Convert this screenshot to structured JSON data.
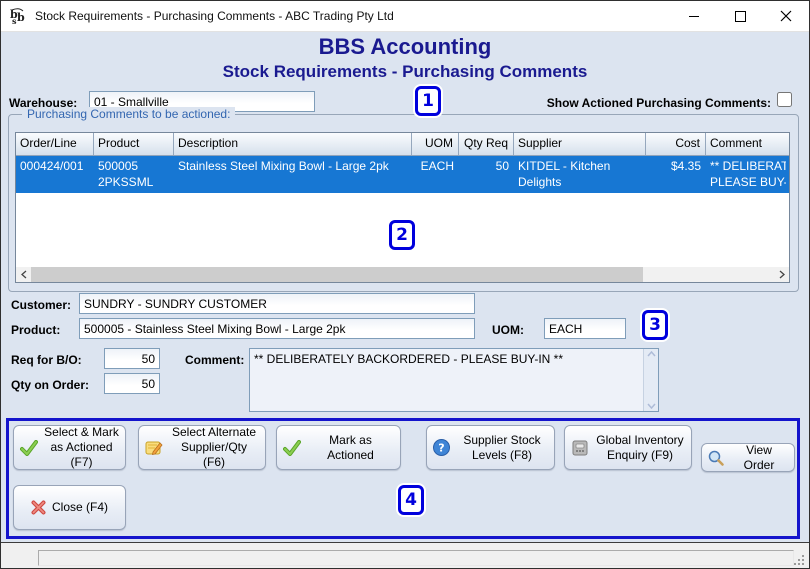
{
  "titlebar": {
    "title": "Stock Requirements - Purchasing Comments - ABC Trading Pty Ltd"
  },
  "header": {
    "app_title": "BBS Accounting",
    "screen_title": "Stock Requirements - Purchasing Comments"
  },
  "toolbar": {
    "warehouse_label": "Warehouse:",
    "warehouse_value": "01 - Smallville",
    "show_actioned_label": "Show Actioned Purchasing Comments:",
    "show_actioned_checked": false
  },
  "annotations": {
    "b1": "1",
    "b2": "2",
    "b3": "3",
    "b4": "4"
  },
  "grid": {
    "group_label": "Purchasing Comments to be actioned:",
    "columns": [
      "Order/Line",
      "Product",
      "Description",
      "UOM",
      "Qty Req",
      "Supplier",
      "Cost",
      "Comment"
    ],
    "rows": [
      {
        "order_line": "000424/001",
        "product": "500005 2PKSSML",
        "description": "Stainless Steel Mixing Bowl - Large 2pk",
        "uom": "EACH",
        "qty_req": "50",
        "supplier": "KITDEL - Kitchen Delights",
        "cost": "$4.35",
        "comment_line1": "** DELIBERATELY BACKORDERED -",
        "comment_line2": "PLEASE BUY-IN **"
      }
    ]
  },
  "detail": {
    "customer_label": "Customer:",
    "customer_value": "SUNDRY - SUNDRY CUSTOMER",
    "product_label": "Product:",
    "product_value": "500005 - Stainless Steel Mixing Bowl - Large 2pk",
    "uom_label": "UOM:",
    "uom_value": "EACH",
    "req_bo_label": "Req for B/O:",
    "req_bo_value": "50",
    "qty_on_order_label": "Qty on Order:",
    "qty_on_order_value": "50",
    "comment_label": "Comment:",
    "comment_value": "** DELIBERATELY BACKORDERED - PLEASE BUY-IN **"
  },
  "actions": {
    "select_mark_label": "Select & Mark as Actioned (F7)",
    "select_alternate_label": "Select Alternate Supplier/Qty (F6)",
    "mark_actioned_label": "Mark as Actioned",
    "supplier_stock_label": "Supplier Stock Levels (F8)",
    "global_inventory_label": "Global Inventory Enquiry (F9)",
    "view_order_label": "View Order",
    "close_label": "Close (F4)"
  },
  "colors": {
    "accent_navy": "#1a1a90",
    "selection_blue": "#1777d3",
    "annotation_blue": "#0000dd",
    "panel_border_blue": "#1414cc",
    "group_label_blue": "#3366b0"
  }
}
